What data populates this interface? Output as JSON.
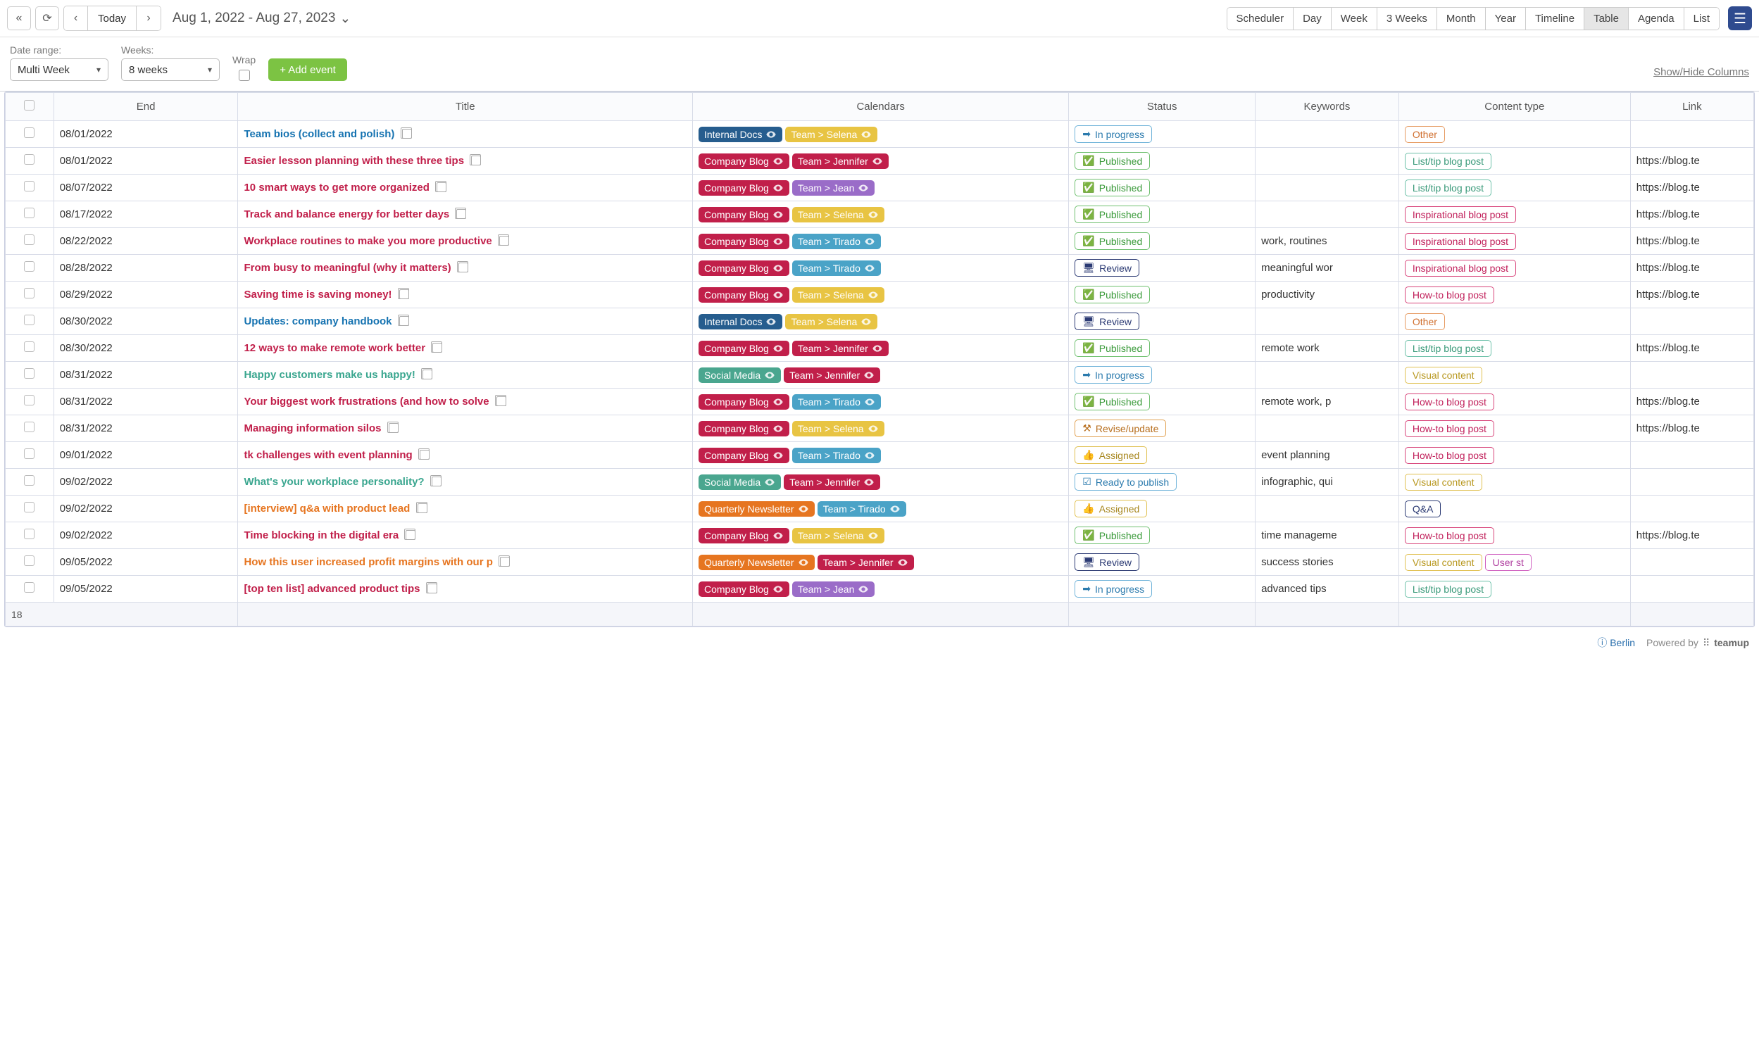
{
  "toolbar": {
    "today": "Today",
    "date_range": "Aug 1, 2022 - Aug 27, 2023",
    "views": [
      "Scheduler",
      "Day",
      "Week",
      "3 Weeks",
      "Month",
      "Year",
      "Timeline",
      "Table",
      "Agenda",
      "List"
    ],
    "active_view": "Table"
  },
  "filters": {
    "date_range_label": "Date range:",
    "date_range_select": "Multi Week",
    "weeks_label": "Weeks:",
    "weeks_select": "8 weeks",
    "wrap_label": "Wrap",
    "add_event": "+ Add event",
    "show_hide": "Show/Hide Columns"
  },
  "columns": [
    "",
    "End",
    "Title",
    "Calendars",
    "Status",
    "Keywords",
    "Content type",
    "Link"
  ],
  "status_icons": {
    "In progress": "➡",
    "Published": "✅",
    "Review": "🖥",
    "Revise/update": "⚒",
    "Assigned": "👍",
    "Ready to publish": "☑"
  },
  "calendar_colors": {
    "Internal Docs": "p-darkblue",
    "Company Blog": "p-crimson",
    "Social Media": "p-green",
    "Quarterly Newsletter": "p-orange",
    "Team > Selena": "p-yellow",
    "Team > Jennifer": "p-crimson",
    "Team > Jean": "p-purple",
    "Team > Tirado": "p-teal"
  },
  "ctype_class": {
    "Other": "ct-other",
    "List/tip blog post": "ct-list",
    "Inspirational blog post": "ct-insp",
    "How-to blog post": "ct-howto",
    "Visual content": "ct-visual",
    "Q&A": "ct-qa",
    "User st": "ct-user"
  },
  "rows": [
    {
      "end": "08/01/2022",
      "title": "Team bios (collect and polish)",
      "title_color": "blue",
      "calendars": [
        "Internal Docs",
        "Team > Selena"
      ],
      "status": "In progress",
      "keywords": "",
      "ctypes": [
        "Other"
      ],
      "link": ""
    },
    {
      "end": "08/01/2022",
      "title": "Easier lesson planning with these three tips",
      "title_color": "",
      "calendars": [
        "Company Blog",
        "Team > Jennifer"
      ],
      "status": "Published",
      "keywords": "",
      "ctypes": [
        "List/tip blog post"
      ],
      "link": "https://blog.te"
    },
    {
      "end": "08/07/2022",
      "title": "10 smart ways to get more organized",
      "title_color": "",
      "calendars": [
        "Company Blog",
        "Team > Jean"
      ],
      "status": "Published",
      "keywords": "",
      "ctypes": [
        "List/tip blog post"
      ],
      "link": "https://blog.te"
    },
    {
      "end": "08/17/2022",
      "title": "Track and balance energy for better days",
      "title_color": "",
      "calendars": [
        "Company Blog",
        "Team > Selena"
      ],
      "status": "Published",
      "keywords": "",
      "ctypes": [
        "Inspirational blog post"
      ],
      "link": "https://blog.te"
    },
    {
      "end": "08/22/2022",
      "title": "Workplace routines to make you more productive",
      "title_color": "",
      "calendars": [
        "Company Blog",
        "Team > Tirado"
      ],
      "status": "Published",
      "keywords": "work, routines",
      "ctypes": [
        "Inspirational blog post"
      ],
      "link": "https://blog.te"
    },
    {
      "end": "08/28/2022",
      "title": "From busy to meaningful (why it matters)",
      "title_color": "",
      "calendars": [
        "Company Blog",
        "Team > Tirado"
      ],
      "status": "Review",
      "keywords": "meaningful wor",
      "ctypes": [
        "Inspirational blog post"
      ],
      "link": "https://blog.te"
    },
    {
      "end": "08/29/2022",
      "title": "Saving time is saving money!",
      "title_color": "",
      "calendars": [
        "Company Blog",
        "Team > Selena"
      ],
      "status": "Published",
      "keywords": "productivity",
      "ctypes": [
        "How-to blog post"
      ],
      "link": "https://blog.te"
    },
    {
      "end": "08/30/2022",
      "title": "Updates: company handbook",
      "title_color": "blue",
      "calendars": [
        "Internal Docs",
        "Team > Selena"
      ],
      "status": "Review",
      "keywords": "",
      "ctypes": [
        "Other"
      ],
      "link": ""
    },
    {
      "end": "08/30/2022",
      "title": "12 ways to make remote work better",
      "title_color": "",
      "calendars": [
        "Company Blog",
        "Team > Jennifer"
      ],
      "status": "Published",
      "keywords": "remote work",
      "ctypes": [
        "List/tip blog post"
      ],
      "link": "https://blog.te"
    },
    {
      "end": "08/31/2022",
      "title": "Happy customers make us happy!",
      "title_color": "green",
      "calendars": [
        "Social Media",
        "Team > Jennifer"
      ],
      "status": "In progress",
      "keywords": "",
      "ctypes": [
        "Visual content"
      ],
      "link": ""
    },
    {
      "end": "08/31/2022",
      "title": "Your biggest work frustrations (and how to solve",
      "title_color": "",
      "calendars": [
        "Company Blog",
        "Team > Tirado"
      ],
      "status": "Published",
      "keywords": "remote work, p",
      "ctypes": [
        "How-to blog post"
      ],
      "link": "https://blog.te"
    },
    {
      "end": "08/31/2022",
      "title": "Managing information silos",
      "title_color": "",
      "calendars": [
        "Company Blog",
        "Team > Selena"
      ],
      "status": "Revise/update",
      "keywords": "",
      "ctypes": [
        "How-to blog post"
      ],
      "link": "https://blog.te"
    },
    {
      "end": "09/01/2022",
      "title": "tk challenges with event planning",
      "title_color": "",
      "calendars": [
        "Company Blog",
        "Team > Tirado"
      ],
      "status": "Assigned",
      "keywords": "event planning",
      "ctypes": [
        "How-to blog post"
      ],
      "link": ""
    },
    {
      "end": "09/02/2022",
      "title": "What's your workplace personality?",
      "title_color": "green",
      "calendars": [
        "Social Media",
        "Team > Jennifer"
      ],
      "status": "Ready to publish",
      "keywords": "infographic, qui",
      "ctypes": [
        "Visual content"
      ],
      "link": ""
    },
    {
      "end": "09/02/2022",
      "title": "[interview] q&a with product lead",
      "title_color": "orange",
      "calendars": [
        "Quarterly Newsletter",
        "Team > Tirado"
      ],
      "status": "Assigned",
      "keywords": "",
      "ctypes": [
        "Q&A"
      ],
      "link": ""
    },
    {
      "end": "09/02/2022",
      "title": "Time blocking in the digital era",
      "title_color": "",
      "calendars": [
        "Company Blog",
        "Team > Selena"
      ],
      "status": "Published",
      "keywords": "time manageme",
      "ctypes": [
        "How-to blog post"
      ],
      "link": "https://blog.te"
    },
    {
      "end": "09/05/2022",
      "title": "How this user increased profit margins with our p",
      "title_color": "orange",
      "calendars": [
        "Quarterly Newsletter",
        "Team > Jennifer"
      ],
      "status": "Review",
      "keywords": "success stories",
      "ctypes": [
        "Visual content",
        "User st"
      ],
      "link": ""
    },
    {
      "end": "09/05/2022",
      "title": "[top ten list] advanced product tips",
      "title_color": "",
      "calendars": [
        "Company Blog",
        "Team > Jean"
      ],
      "status": "In progress",
      "keywords": "advanced tips",
      "ctypes": [
        "List/tip blog post"
      ],
      "link": ""
    }
  ],
  "row_count": "18",
  "footer": {
    "tz": "Berlin",
    "powered": "Powered by",
    "brand": "teamup"
  }
}
